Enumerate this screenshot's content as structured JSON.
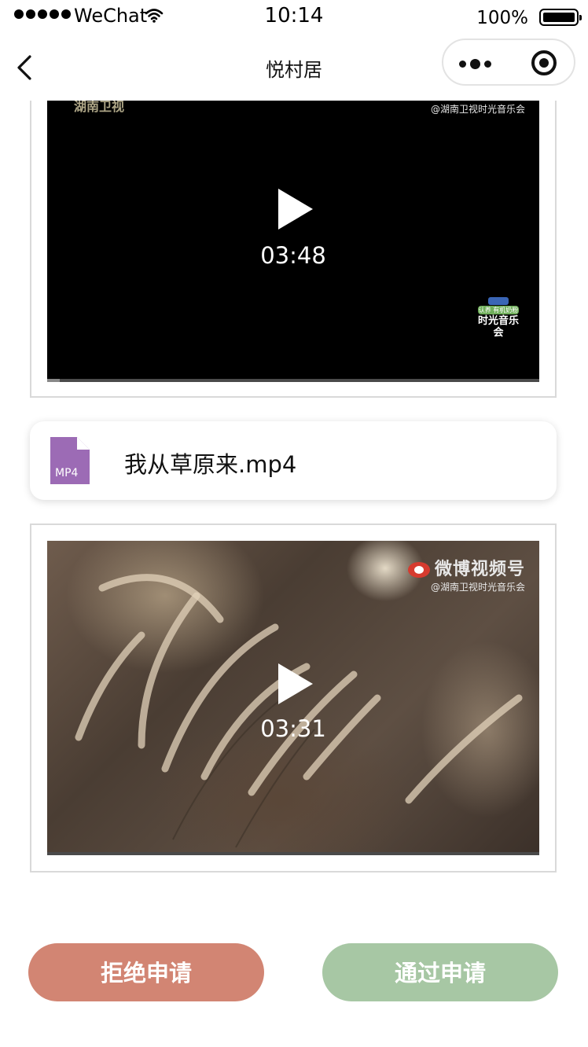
{
  "status_bar": {
    "carrier": "WeChat",
    "time": "10:14",
    "battery_text": "100%",
    "battery_level": 1.0
  },
  "nav": {
    "title": "悦村居",
    "back_icon": "chevron-left-icon",
    "more_icon": "more-dots-icon",
    "close_icon": "target-circle-icon"
  },
  "videos": [
    {
      "duration": "03:48",
      "progress": 0.025,
      "watermark_top": "湖南卫视",
      "watermark_channel": "@湖南卫视时光音乐会",
      "show_logo_band": "认养 有机奶粉",
      "show_logo_word": "时光音乐会"
    },
    {
      "duration": "03:31",
      "progress": 0.0,
      "watermark_title": "微博视频号",
      "watermark_channel": "@湖南卫视时光音乐会"
    }
  ],
  "file": {
    "icon_label": "MP4",
    "icon_color": "#9c6bb5",
    "name": "我从草原来.mp4"
  },
  "actions": {
    "reject_label": "拒绝申请",
    "reject_color": "#d28573",
    "approve_label": "通过申请",
    "approve_color": "#a7c7a4"
  }
}
